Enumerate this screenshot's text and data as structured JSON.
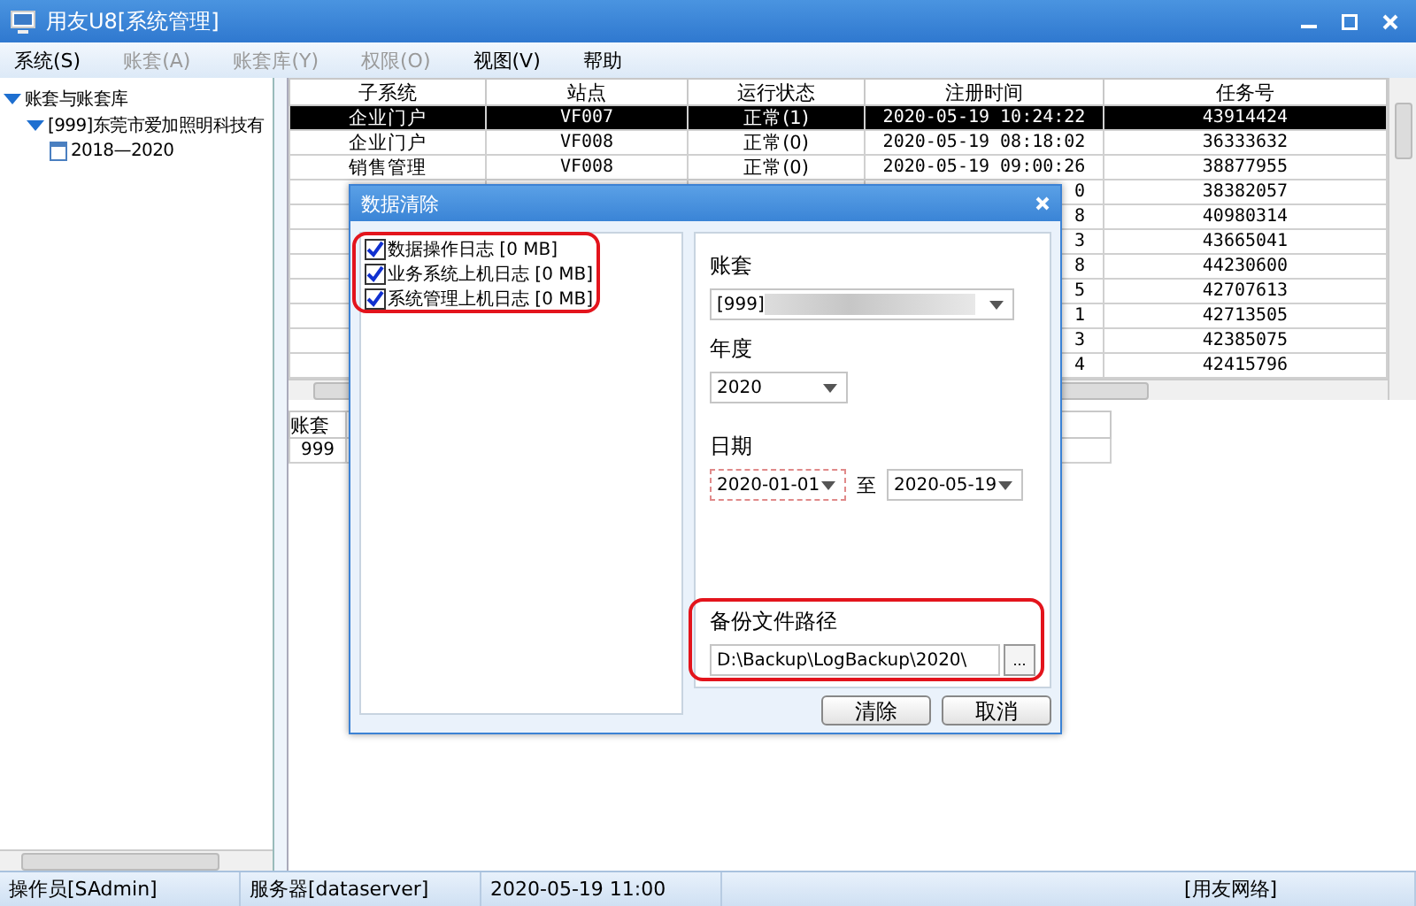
{
  "window": {
    "title": "用友U8[系统管理]"
  },
  "menu": [
    {
      "label": "系统(S)",
      "disabled": false
    },
    {
      "label": "账套(A)",
      "disabled": true
    },
    {
      "label": "账套库(Y)",
      "disabled": true
    },
    {
      "label": "权限(O)",
      "disabled": true
    },
    {
      "label": "视图(V)",
      "disabled": false
    },
    {
      "label": "帮助",
      "disabled": false
    }
  ],
  "tree": [
    {
      "label": "账套与账套库",
      "expanded": true,
      "children": [
        {
          "label": "[999]东莞市爱加照明科技有",
          "expanded": true,
          "children": [
            {
              "label": "2018—2020"
            }
          ]
        }
      ]
    }
  ],
  "table": {
    "columns": [
      "子系统",
      "站点",
      "运行状态",
      "注册时间",
      "任务号"
    ],
    "rows": [
      {
        "subsystem": "企业门户",
        "station": "VF007",
        "status": "正常(1)",
        "time": "2020-05-19 10:24:22",
        "task_no": "43914424",
        "selected": true
      },
      {
        "subsystem": "企业门户",
        "station": "VF008",
        "status": "正常(0)",
        "time": "2020-05-19 08:18:02",
        "task_no": "36333632",
        "selected": false
      },
      {
        "subsystem": "销售管理",
        "station": "VF008",
        "status": "正常(0)",
        "time": "2020-05-19 09:00:26",
        "task_no": "38877955",
        "selected": false
      },
      {
        "time": "0",
        "task_no": "38382057",
        "selected": false
      },
      {
        "time": "8",
        "task_no": "40980314",
        "selected": false
      },
      {
        "time": "3",
        "task_no": "43665041",
        "selected": false
      },
      {
        "time": "8",
        "task_no": "44230600",
        "selected": false
      },
      {
        "time": "5",
        "task_no": "42707613",
        "selected": false
      },
      {
        "time": "1",
        "task_no": "42713505",
        "selected": false
      },
      {
        "time": "3",
        "task_no": "42385075",
        "selected": false
      },
      {
        "time": "4",
        "task_no": "42415796",
        "selected": false
      }
    ]
  },
  "lower_table": {
    "columns": [
      "账套"
    ],
    "rows": [
      [
        "999"
      ]
    ]
  },
  "dialog": {
    "title": "数据清除",
    "logs": [
      {
        "label": "数据操作日志 [0 MB]",
        "checked": true
      },
      {
        "label": "业务系统上机日志 [0 MB]",
        "checked": true
      },
      {
        "label": "系统管理上机日志 [0 MB]",
        "checked": true
      }
    ],
    "account_label": "账套",
    "account_value": "[999]",
    "year_label": "年度",
    "year_value": "2020",
    "date_label": "日期",
    "date_from": "2020-01-01",
    "date_sep": "至",
    "date_to": "2020-05-19",
    "backup_label": "备份文件路径",
    "backup_path": "D:\\Backup\\LogBackup\\2020\\",
    "browse_button": "...",
    "buttons": [
      "清除",
      "取消"
    ]
  },
  "status_bar": [
    "操作员[SAdmin]",
    "服务器[dataserver]",
    "2020-05-19 11:00",
    "[用友网络]"
  ]
}
